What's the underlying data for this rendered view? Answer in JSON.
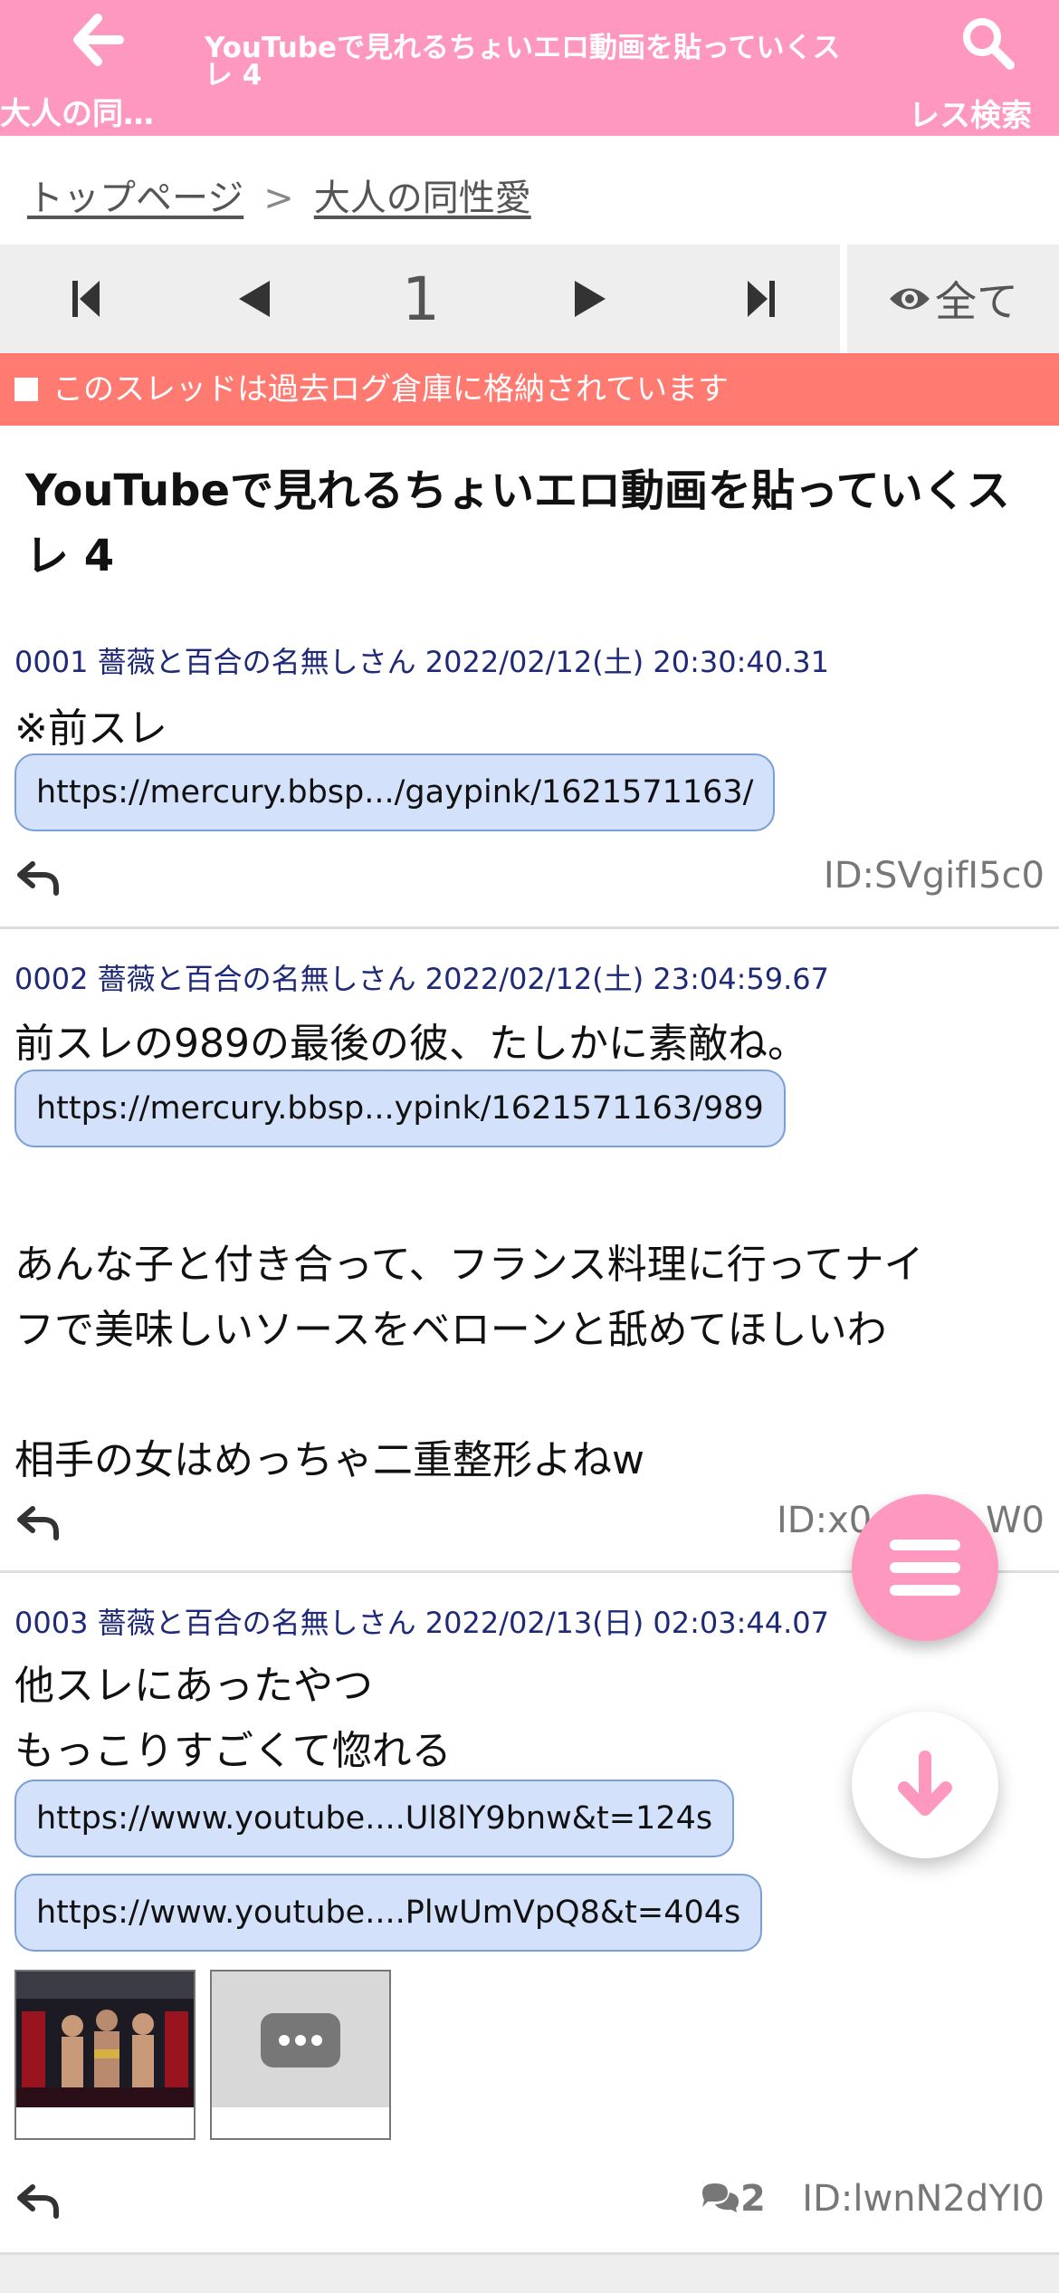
{
  "header": {
    "back_label": "大人の同…",
    "title": "YouTubeで見れるちょいエロ動画を貼っていくスレ 4",
    "search_label": "レス検索",
    "color": "#ff98bf"
  },
  "breadcrumb": {
    "home": "トップページ",
    "separator": ">",
    "board": "大人の同性愛"
  },
  "pager": {
    "page": "1",
    "all_label": "全て"
  },
  "notice": {
    "text": "このスレッドは過去ログ倉庫に格納されています",
    "color": "#ff7b72"
  },
  "thread": {
    "title": "YouTubeで見れるちょいエロ動画を貼っていくスレ 4"
  },
  "posts": [
    {
      "meta": "0001 薔薇と百合の名無しさん 2022/02/12(土) 20:30:40.31",
      "lines": [
        "※前スレ"
      ],
      "links": [
        "https://mercury.bbsp.../gaypink/1621571163/"
      ],
      "id": "ID:SVgifI5c0"
    },
    {
      "meta": "0002 薔薇と百合の名無しさん 2022/02/12(土) 23:04:59.67",
      "lines": [
        "前スレの989の最後の彼、たしかに素敵ね。",
        "あんな子と付き合って、フランス料理に行ってナイ",
        "フで美味しいソースをベローンと舐めてほしいわ",
        "相手の女はめっちゃ二重整形よねw"
      ],
      "links": [
        "https://mercury.bbsp...ypink/1621571163/989"
      ],
      "id": "ID:x0",
      "id_tail": "W0"
    },
    {
      "meta": "0003 薔薇と百合の名無しさん 2022/02/13(日) 02:03:44.07",
      "lines": [
        "他スレにあったやつ",
        "もっこりすごくて惚れる"
      ],
      "links": [
        "https://www.youtube....Ul8lY9bnw&t=124s",
        "https://www.youtube....PlwUmVpQ8&t=404s"
      ],
      "reply_count": "2",
      "id": "ID:lwnN2dYI0"
    }
  ],
  "icons": {
    "back": "arrow-left-icon",
    "search": "search-icon",
    "reply": "reply-icon",
    "menu": "menu-icon",
    "down": "arrow-down-icon",
    "comments": "comments-icon",
    "eye": "eye-icon"
  }
}
